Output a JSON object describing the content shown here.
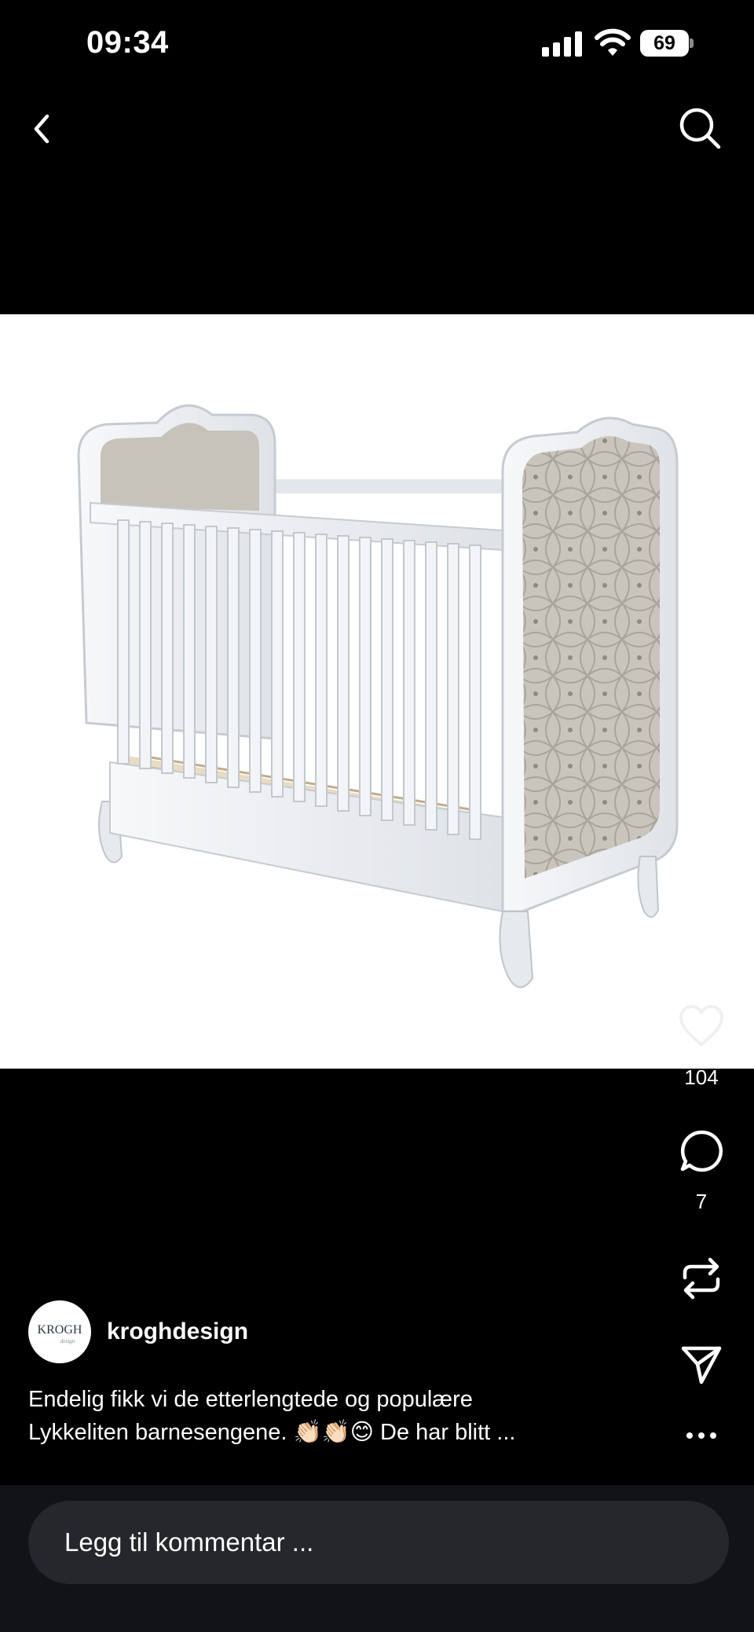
{
  "status_bar": {
    "time": "09:34",
    "battery_level": "69"
  },
  "nav": {
    "back_icon": "chevron-left-icon",
    "search_icon": "search-icon"
  },
  "post": {
    "image_subject": "white crib with tufted grey headboards",
    "actions": {
      "like_count": "104",
      "comment_count": "7"
    },
    "author": {
      "username": "kroghdesign",
      "avatar_text": "KROGH",
      "avatar_subtext": "design"
    },
    "caption": {
      "line1": "Endelig fikk vi de etterlengtede og populære",
      "line2": "Lykkeliten barnesengene. 👏🏻👏🏻😊 De har blitt ..."
    }
  },
  "comment": {
    "placeholder": "Legg til kommentar ..."
  },
  "colors": {
    "background": "#000000",
    "comment_bar": "#111317",
    "comment_field": "#25272c"
  }
}
